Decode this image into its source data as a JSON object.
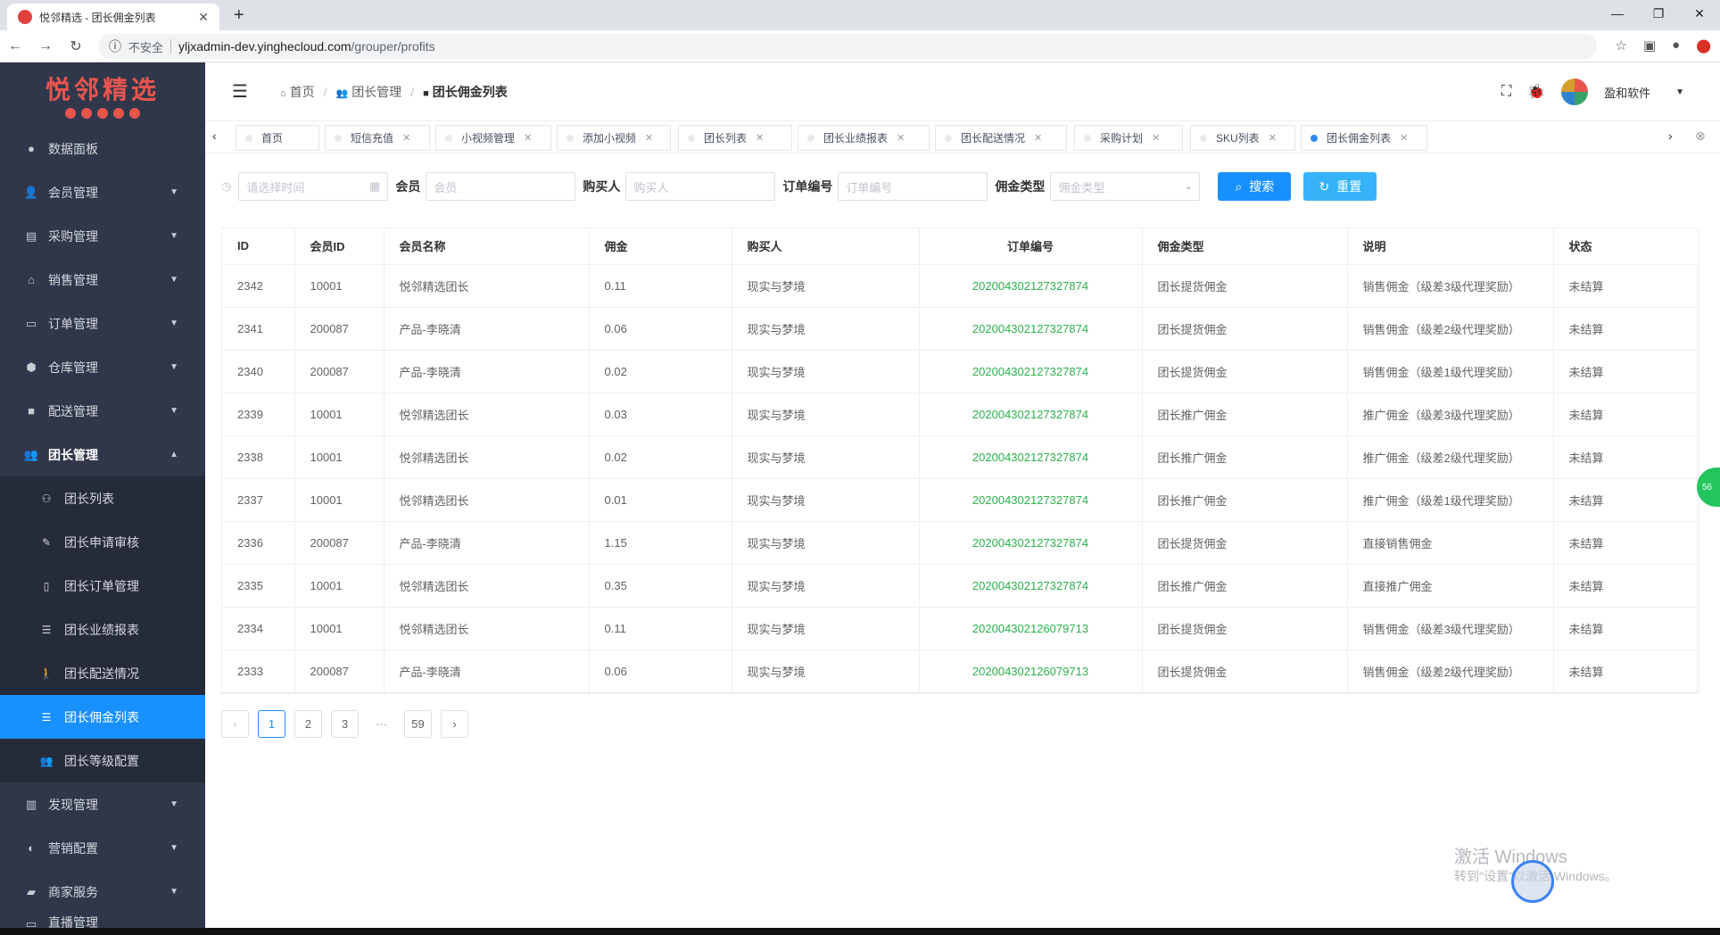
{
  "browser": {
    "tab_title": "悦邻精选 - 团长佣金列表",
    "insecure_label": "不安全",
    "url_host": "yljxadmin-dev.yinghecloud.com",
    "url_path": "/grouper/profits"
  },
  "sidebar": {
    "brand": "悦邻精选",
    "items": [
      {
        "label": "数据面板",
        "icon": "dashboard-icon"
      },
      {
        "label": "会员管理",
        "icon": "member-icon"
      },
      {
        "label": "采购管理",
        "icon": "purchase-icon"
      },
      {
        "label": "销售管理",
        "icon": "sales-icon"
      },
      {
        "label": "订单管理",
        "icon": "order-icon"
      },
      {
        "label": "仓库管理",
        "icon": "warehouse-icon"
      },
      {
        "label": "配送管理",
        "icon": "delivery-icon"
      },
      {
        "label": "团长管理",
        "icon": "grouper-icon"
      },
      {
        "label": "发现管理",
        "icon": "discover-icon"
      },
      {
        "label": "营销配置",
        "icon": "marketing-icon"
      },
      {
        "label": "商家服务",
        "icon": "merchant-icon"
      },
      {
        "label": "直播管理",
        "icon": "live-icon"
      }
    ],
    "subitems": [
      {
        "label": "团长列表",
        "icon": "group-list-icon"
      },
      {
        "label": "团长申请审核",
        "icon": "edit-icon"
      },
      {
        "label": "团长订单管理",
        "icon": "document-icon"
      },
      {
        "label": "团长业绩报表",
        "icon": "list-icon"
      },
      {
        "label": "团长配送情况",
        "icon": "walker-icon"
      },
      {
        "label": "团长佣金列表",
        "icon": "list-icon"
      },
      {
        "label": "团长等级配置",
        "icon": "users-icon"
      }
    ]
  },
  "header": {
    "breadcrumb": [
      "首页",
      "团长管理",
      "团长佣金列表"
    ],
    "company": "盈和软件"
  },
  "tags": [
    "首页",
    "短信充值",
    "小视频管理",
    "添加小视频",
    "团长列表",
    "团长业绩报表",
    "团长配送情况",
    "采购计划",
    "SKU列表",
    "团长佣金列表"
  ],
  "filter": {
    "date_placeholder": "请选择时间",
    "member_label": "会员",
    "member_placeholder": "会员",
    "buyer_label": "购买人",
    "buyer_placeholder": "购买人",
    "order_label": "订单编号",
    "order_placeholder": "订单编号",
    "type_label": "佣金类型",
    "type_placeholder": "佣金类型",
    "search_label": "搜索",
    "reset_label": "重置"
  },
  "table": {
    "columns": [
      "ID",
      "会员ID",
      "会员名称",
      "佣金",
      "购买人",
      "订单编号",
      "佣金类型",
      "说明",
      "状态"
    ],
    "rows": [
      [
        "2342",
        "10001",
        "悦邻精选团长",
        "0.11",
        "现实与梦境",
        "202004302127327874",
        "团长提货佣金",
        "销售佣金（级差3级代理奖励）",
        "未结算"
      ],
      [
        "2341",
        "200087",
        "产品-李晓清",
        "0.06",
        "现实与梦境",
        "202004302127327874",
        "团长提货佣金",
        "销售佣金（级差2级代理奖励）",
        "未结算"
      ],
      [
        "2340",
        "200087",
        "产品-李晓清",
        "0.02",
        "现实与梦境",
        "202004302127327874",
        "团长提货佣金",
        "销售佣金（级差1级代理奖励）",
        "未结算"
      ],
      [
        "2339",
        "10001",
        "悦邻精选团长",
        "0.03",
        "现实与梦境",
        "202004302127327874",
        "团长推广佣金",
        "推广佣金（级差3级代理奖励）",
        "未结算"
      ],
      [
        "2338",
        "10001",
        "悦邻精选团长",
        "0.02",
        "现实与梦境",
        "202004302127327874",
        "团长推广佣金",
        "推广佣金（级差2级代理奖励）",
        "未结算"
      ],
      [
        "2337",
        "10001",
        "悦邻精选团长",
        "0.01",
        "现实与梦境",
        "202004302127327874",
        "团长推广佣金",
        "推广佣金（级差1级代理奖励）",
        "未结算"
      ],
      [
        "2336",
        "200087",
        "产品-李晓清",
        "1.15",
        "现实与梦境",
        "202004302127327874",
        "团长提货佣金",
        "直接销售佣金",
        "未结算"
      ],
      [
        "2335",
        "10001",
        "悦邻精选团长",
        "0.35",
        "现实与梦境",
        "202004302127327874",
        "团长推广佣金",
        "直接推广佣金",
        "未结算"
      ],
      [
        "2334",
        "10001",
        "悦邻精选团长",
        "0.11",
        "现实与梦境",
        "202004302126079713",
        "团长提货佣金",
        "销售佣金（级差3级代理奖励）",
        "未结算"
      ],
      [
        "2333",
        "200087",
        "产品-李晓清",
        "0.06",
        "现实与梦境",
        "202004302126079713",
        "团长提货佣金",
        "销售佣金（级差2级代理奖励）",
        "未结算"
      ]
    ]
  },
  "pagination": {
    "pages": [
      "1",
      "2",
      "3"
    ],
    "ellipsis": "···",
    "last": "59",
    "current": "1"
  },
  "watermark": {
    "line1": "激活 Windows",
    "line2": "转到\"设置\"以激活 Windows。"
  },
  "side_badge": "56",
  "colors": {
    "sidebar_bg": "#30374a",
    "active": "#1890ff",
    "order_link": "#2ab14b",
    "reset_btn": "#36b3f8"
  }
}
